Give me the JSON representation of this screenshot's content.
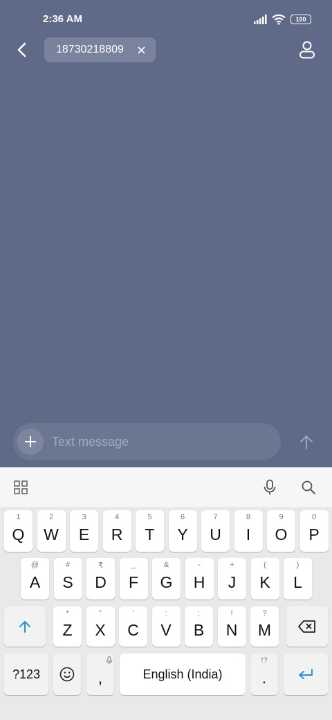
{
  "status_bar": {
    "time": "2:36 AM",
    "battery": "100"
  },
  "header": {
    "recipient": "18730218809"
  },
  "compose": {
    "placeholder": "Text message"
  },
  "keyboard": {
    "row1": [
      {
        "hint": "1",
        "key": "Q"
      },
      {
        "hint": "2",
        "key": "W"
      },
      {
        "hint": "3",
        "key": "E"
      },
      {
        "hint": "4",
        "key": "R"
      },
      {
        "hint": "5",
        "key": "T"
      },
      {
        "hint": "6",
        "key": "Y"
      },
      {
        "hint": "7",
        "key": "U"
      },
      {
        "hint": "8",
        "key": "I"
      },
      {
        "hint": "9",
        "key": "O"
      },
      {
        "hint": "0",
        "key": "P"
      }
    ],
    "row2": [
      {
        "hint": "@",
        "key": "A"
      },
      {
        "hint": "#",
        "key": "S"
      },
      {
        "hint": "₹",
        "key": "D"
      },
      {
        "hint": "_",
        "key": "F"
      },
      {
        "hint": "&",
        "key": "G"
      },
      {
        "hint": "-",
        "key": "H"
      },
      {
        "hint": "+",
        "key": "J"
      },
      {
        "hint": "(",
        "key": "K"
      },
      {
        "hint": ")",
        "key": "L"
      }
    ],
    "row3": [
      {
        "hint": "*",
        "key": "Z"
      },
      {
        "hint": "\"",
        "key": "X"
      },
      {
        "hint": "'",
        "key": "C"
      },
      {
        "hint": ":",
        "key": "V"
      },
      {
        "hint": ";",
        "key": "B"
      },
      {
        "hint": "!",
        "key": "N"
      },
      {
        "hint": "?",
        "key": "M"
      }
    ],
    "symbols_label": "?123",
    "comma": ",",
    "space_label": "English (India)",
    "period": ".",
    "period_hint": "!?"
  },
  "colors": {
    "accent": "#2196d3",
    "background": "#5e6a87"
  }
}
